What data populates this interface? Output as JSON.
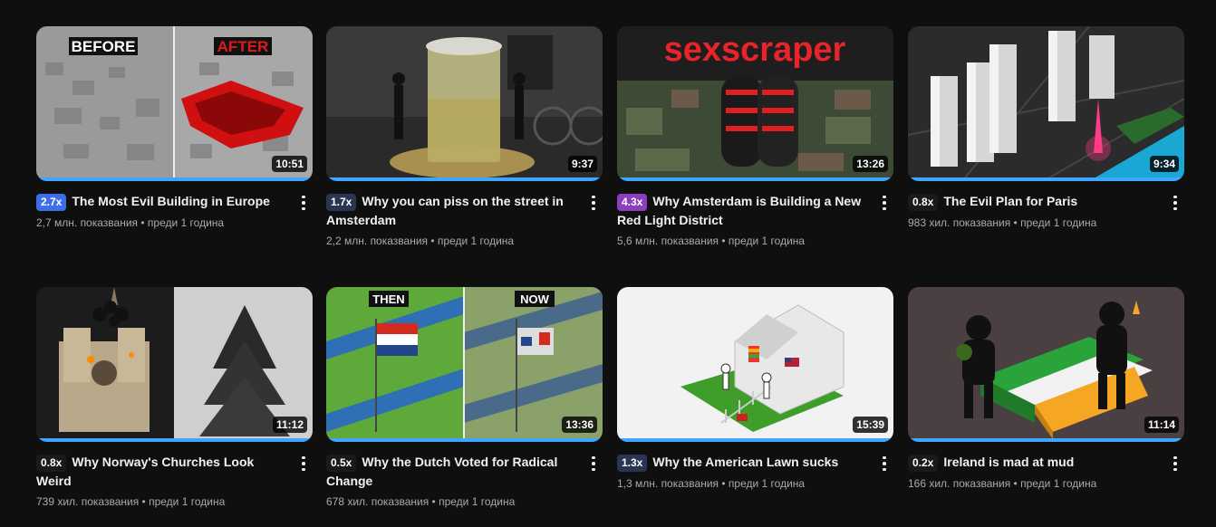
{
  "videos": [
    {
      "speed": "2.7x",
      "badge_color": "#3b6ee8",
      "title": "The Most Evil Building in Europe",
      "views": "2,7 млн. показвания",
      "age": "преди 1 година",
      "duration": "10:51",
      "thumb_labels": [
        "BEFORE",
        "AFTER"
      ]
    },
    {
      "speed": "1.7x",
      "badge_color": "#2b3552",
      "title": "Why you can piss on the street in Amsterdam",
      "views": "2,2 млн. показвания",
      "age": "преди 1 година",
      "duration": "9:37"
    },
    {
      "speed": "4.3x",
      "badge_color": "#8b3fbf",
      "title": "Why Amsterdam is Building a New Red Light District",
      "views": "5,6 млн. показвания",
      "age": "преди 1 година",
      "duration": "13:26",
      "thumb_labels": [
        "sexscraper"
      ]
    },
    {
      "speed": "0.8x",
      "badge_color": "#1a1a1a",
      "title": "The Evil Plan for Paris",
      "views": "983 хил. показвания",
      "age": "преди 1 година",
      "duration": "9:34"
    },
    {
      "speed": "0.8x",
      "badge_color": "#1a1a1a",
      "title": "Why Norway's Churches Look Weird",
      "views": "739 хил. показвания",
      "age": "преди 1 година",
      "duration": "11:12"
    },
    {
      "speed": "0.5x",
      "badge_color": "#1a1a1a",
      "title": "Why the Dutch Voted for Radical Change",
      "views": "678 хил. показвания",
      "age": "преди 1 година",
      "duration": "13:36",
      "thumb_labels": [
        "THEN",
        "NOW"
      ]
    },
    {
      "speed": "1.3x",
      "badge_color": "#2b3552",
      "title": "Why the American Lawn sucks",
      "views": "1,3 млн. показвания",
      "age": "преди 1 година",
      "duration": "15:39"
    },
    {
      "speed": "0.2x",
      "badge_color": "#1a1a1a",
      "title": "Ireland is mad at mud",
      "views": "166 хил. показвания",
      "age": "преди 1 година",
      "duration": "11:14"
    }
  ],
  "meta_separator": "•"
}
